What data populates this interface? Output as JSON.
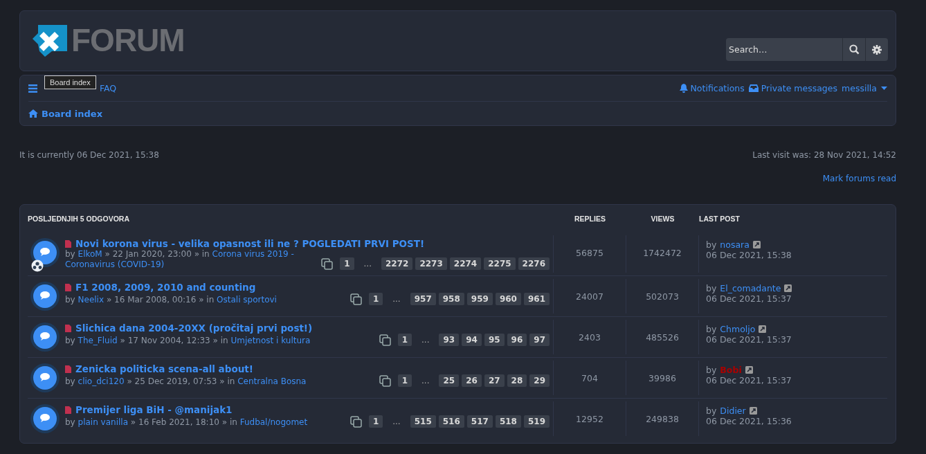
{
  "header": {
    "logo_text": "FORUM",
    "search": {
      "placeholder": "Search…"
    }
  },
  "nav": {
    "faq": "FAQ",
    "tooltip": "Board index",
    "notifications": "Notifications",
    "private_messages": "Private messages",
    "user": "messilla",
    "breadcrumb": "Board index"
  },
  "info": {
    "current_time": "It is currently 06 Dec 2021, 15:38",
    "last_visit": "Last visit was: 28 Nov 2021, 14:52",
    "mark_read": "Mark forums read"
  },
  "table": {
    "columns": [
      "POSLJEDNJIH 5 ODGOVORA",
      "REPLIES",
      "VIEWS",
      "LAST POST"
    ],
    "rows": [
      {
        "title": "Novi korona virus - velika opasnost ili ne ? POGLEDATI PRVI POST!",
        "by": "by",
        "author": "ElkoM",
        "date": "» 22 Jan 2020, 23:00 » in",
        "forum": "Corona virus 2019 - Coronavirus (COVID-19)",
        "forum_icon": true,
        "pages": [
          "1",
          "...",
          "2272",
          "2273",
          "2274",
          "2275",
          "2276"
        ],
        "replies": "56875",
        "views": "1742472",
        "last_by": "by",
        "last_author": "nosara",
        "color": "#3d8ff5",
        "last_date": "06 Dec 2021, 15:38"
      },
      {
        "title": "F1 2008, 2009, 2010 and counting",
        "by": "by",
        "author": "Neelix",
        "date": "» 16 Mar 2008, 00:16 » in",
        "forum": "Ostali sportovi",
        "forum_icon": false,
        "pages": [
          "1",
          "...",
          "957",
          "958",
          "959",
          "960",
          "961"
        ],
        "replies": "24007",
        "views": "502073",
        "last_by": "by",
        "last_author": "El_comadante",
        "color": "#3d8ff5",
        "last_date": "06 Dec 2021, 15:37"
      },
      {
        "title": "Slichica dana 2004-20XX (pročitaj prvi post!)",
        "by": "by",
        "author": "The_Fluid",
        "date": "» 17 Nov 2004, 12:33 » in",
        "forum": "Umjetnost i kultura",
        "forum_icon": false,
        "pages": [
          "1",
          "...",
          "93",
          "94",
          "95",
          "96",
          "97"
        ],
        "replies": "2403",
        "views": "485526",
        "last_by": "by",
        "last_author": "Chmoljo",
        "color": "#3d8ff5",
        "last_date": "06 Dec 2021, 15:37"
      },
      {
        "title": "Zenicka politicka scena-all about!",
        "by": "by",
        "author": "clio_dci120",
        "date": "» 25 Dec 2019, 07:53 » in",
        "forum": "Centralna Bosna",
        "forum_icon": false,
        "pages": [
          "1",
          "...",
          "25",
          "26",
          "27",
          "28",
          "29"
        ],
        "replies": "704",
        "views": "39986",
        "last_by": "by",
        "last_author": "Bobi",
        "color": "#aa0000",
        "last_date": "06 Dec 2021, 15:37"
      },
      {
        "title": "Premijer liga BiH - @manijak1",
        "by": "by",
        "author": "plain vanilla",
        "date": "» 16 Feb 2021, 18:10 » in",
        "forum": "Fudbal/nogomet",
        "forum_icon": false,
        "pages": [
          "1",
          "...",
          "515",
          "516",
          "517",
          "518",
          "519"
        ],
        "replies": "12952",
        "views": "249838",
        "last_by": "by",
        "last_author": "Didier",
        "color": "#3d8ff5",
        "last_date": "06 Dec 2021, 15:36"
      }
    ]
  }
}
